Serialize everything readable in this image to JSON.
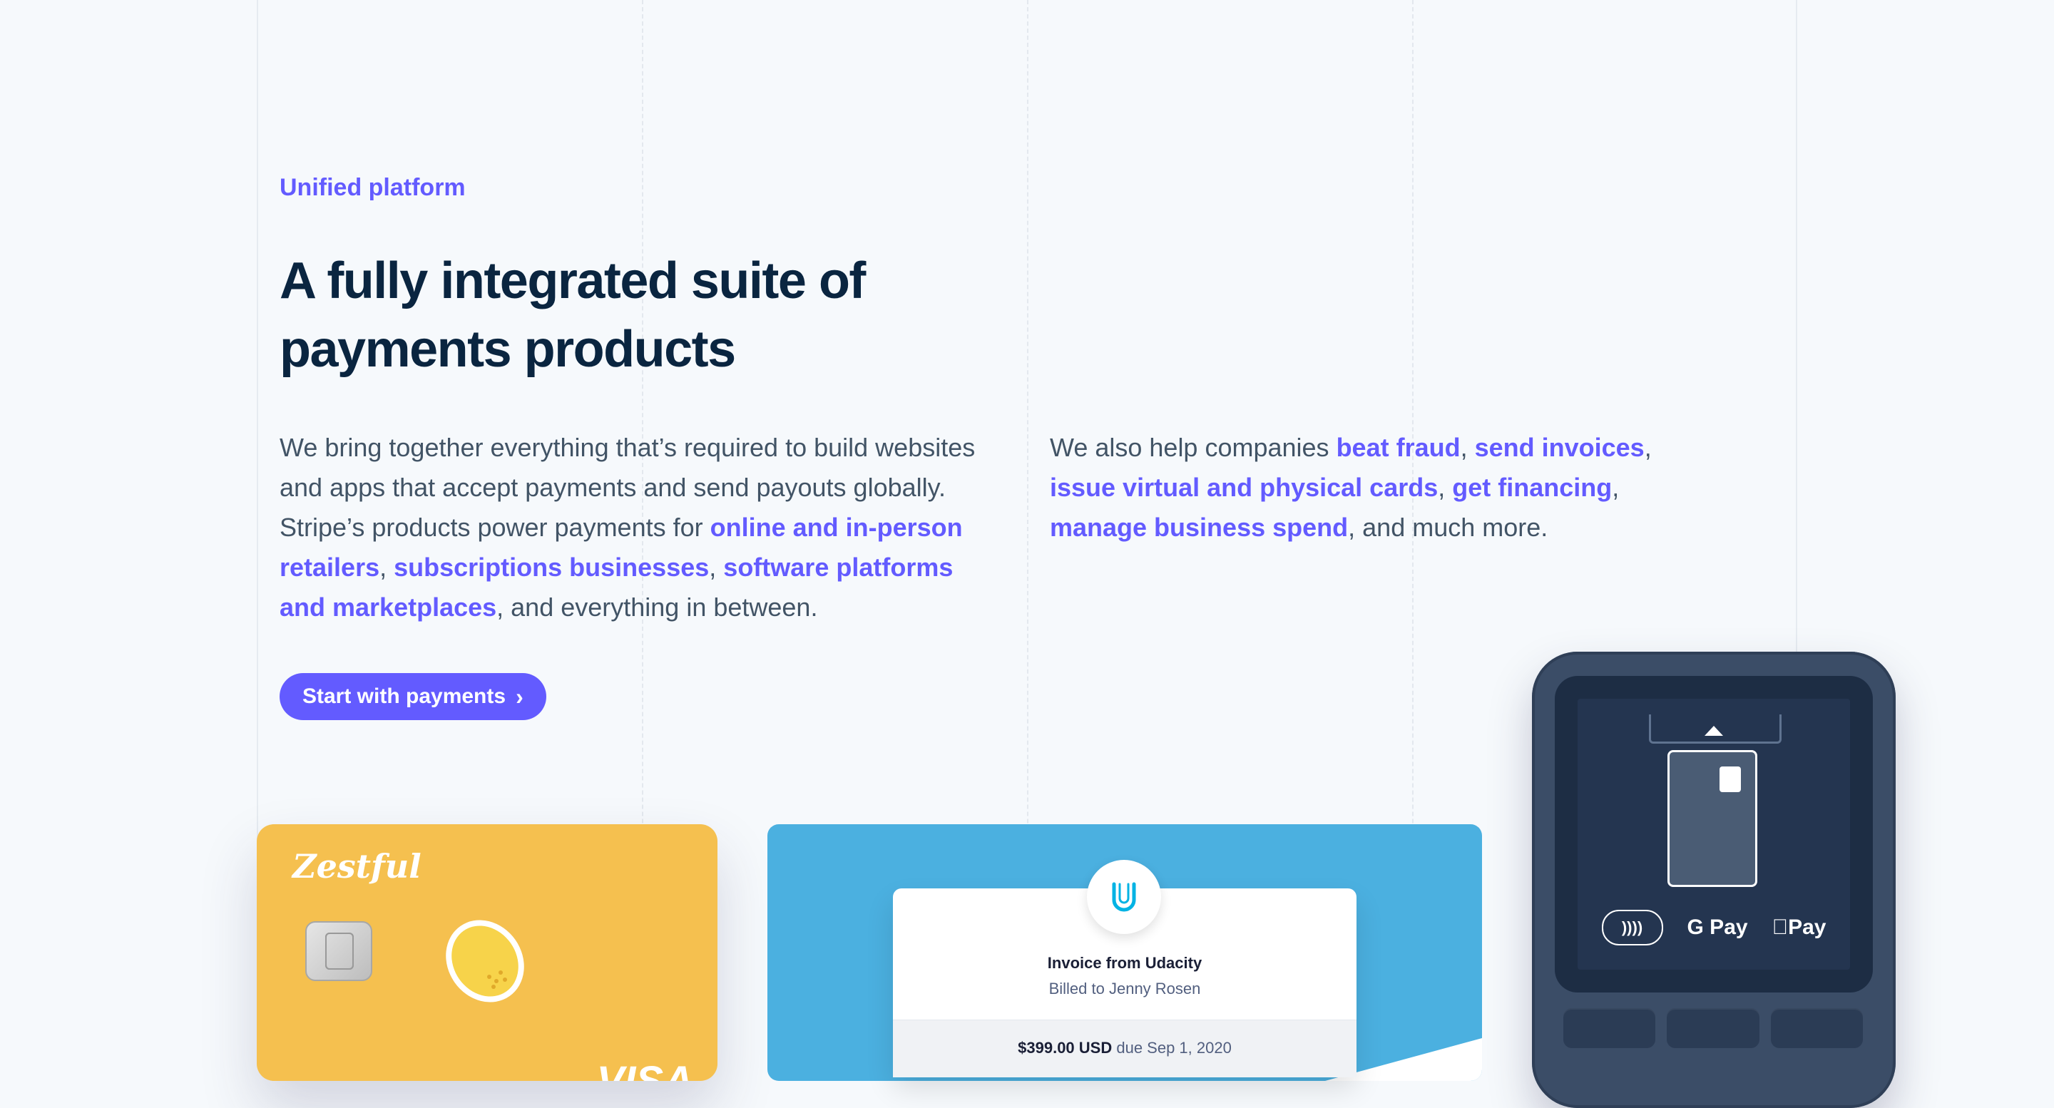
{
  "hero": {
    "eyebrow": "Unified platform",
    "headline": "A fully integrated suite of payments products",
    "cta_label": "Start with payments"
  },
  "intro": {
    "text1": "We bring together everything that’s required to build websites and apps that accept payments and send payouts globally. Stripe’s products power payments for ",
    "link1": "online and in-person retailers",
    "sep1": ", ",
    "link2": "subscriptions businesses",
    "sep2": ", ",
    "link3": "software platforms and marketplaces",
    "text2": ", and everything in between."
  },
  "more": {
    "text1": "We also help companies ",
    "link1": "beat fraud",
    "sep1": ", ",
    "link2": "send invoices",
    "sep2": ", ",
    "link3": "issue virtual and physical cards",
    "sep3": ", ",
    "link4": "get financing",
    "sep4": ", ",
    "link5": "manage business spend",
    "text2": ", and much more."
  },
  "card": {
    "brand": "Zestful",
    "network": "VISA"
  },
  "invoice": {
    "title": "Invoice from Udacity",
    "billed_to": "Billed to Jenny Rosen",
    "amount": "$399.00 USD",
    "due": "due Sep 1, 2020"
  },
  "terminal": {
    "gpay": "G Pay",
    "applepay": "Pay",
    "nfc": "))))"
  },
  "colors": {
    "accent": "#635bff",
    "heading": "#0a2540",
    "body": "#425466",
    "card_yellow": "#f5c04f",
    "invoice_blue": "#4bb0e0",
    "terminal": "#3b4d67"
  }
}
